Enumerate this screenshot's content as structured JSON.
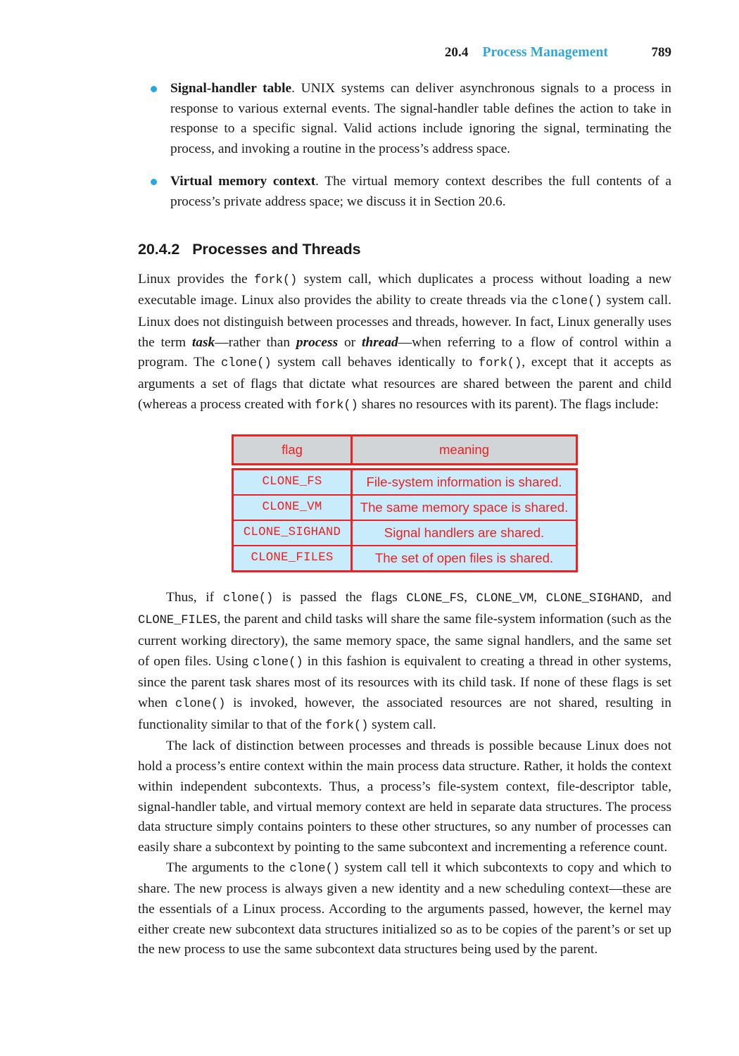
{
  "colors": {
    "accent_blue": "#2da5db",
    "bullet_blue": "#29a8de",
    "table_red": "#ee2020",
    "table_header_gray": "#d2d5d7",
    "table_row_blue": "#c8ecfb",
    "text_black": "#1a1a1a"
  },
  "header": {
    "section_number": "20.4",
    "section_title": "Process Management",
    "page_number": "789"
  },
  "bullets": [
    {
      "lead": "Signal-handler table",
      "text": ". UNIX systems can deliver asynchronous signals to a process in response to various external events. The signal-handler table defines the action to take in response to a specific signal. Valid actions include ignoring the signal, terminating the process, and invoking a routine in the process’s address space."
    },
    {
      "lead": "Virtual memory context",
      "text": ". The virtual memory context describes the full contents of a process’s private address space; we discuss it in Section 20.6."
    }
  ],
  "section": {
    "number": "20.4.2",
    "title": "Processes and Threads"
  },
  "paragraphs": {
    "p1": {
      "s1": "Linux provides the ",
      "c1": "fork()",
      "s2": " system call, which duplicates a process without loading a new executable image. Linux also provides the ability to create threads via the ",
      "c2": "clone()",
      "s3": " system call. Linux does not distinguish between processes and threads, however. In fact, Linux generally uses the term ",
      "i1": "task",
      "s4": "—rather than ",
      "i2": "process",
      "s5": " or ",
      "i3": "thread",
      "s6": "—when referring to a flow of control within a program. The ",
      "c3": "clone()",
      "s7": " system call behaves identically to ",
      "c4": "fork()",
      "s8": ", except that it accepts as arguments a set of flags that dictate what resources are shared between the parent and child (whereas a process created with ",
      "c5": "fork()",
      "s9": " shares no resources with its parent). The flags include:"
    },
    "p2": {
      "s1": "Thus, if ",
      "c1": "clone()",
      "s2": " is passed the flags ",
      "c2": "CLONE_FS",
      "s3": ", ",
      "c3": "CLONE_VM",
      "s4": ", ",
      "c4": "CLONE_SIGHAND",
      "s5": ", and ",
      "c5": "CLONE_FILES",
      "s6": ", the parent and child tasks will share the same file-system information (such as the current working directory), the same memory space, the same signal handlers, and the same set of open files. Using ",
      "c6": "clone()",
      "s7": " in this fashion is equivalent to creating a thread in other systems, since the parent task shares most of its resources with its child task. If none of these flags is set when ",
      "c7": "clone()",
      "s8": " is invoked, however, the associated resources are not shared, resulting in functionality similar to that of the ",
      "c8": "fork()",
      "s9": " system call."
    },
    "p3": {
      "s1": "The lack of distinction between processes and threads is possible because Linux does not hold a process’s entire context within the main process data structure. Rather, it holds the context within independent subcontexts. Thus, a process’s file-system context, file-descriptor table, signal-handler table, and virtual memory context are held in separate data structures. The process data structure simply contains pointers to these other structures, so any number of processes can easily share a subcontext by pointing to the same subcontext and incrementing a reference count."
    },
    "p4": {
      "s1": "The arguments to the ",
      "c1": "clone()",
      "s2": " system call tell it which subcontexts to copy and which to share. The new process is always given a new identity and a new scheduling context—these are the essentials of a Linux process. According to the arguments passed, however, the kernel may either create new subcontext data structures initialized so as to be copies of the parent’s or set up the new process to use the same subcontext data structures being used by the parent."
    }
  },
  "table": {
    "columns": [
      "flag",
      "meaning"
    ],
    "rows": [
      {
        "flag": "CLONE_FS",
        "meaning": "File-system information is shared."
      },
      {
        "flag": "CLONE_VM",
        "meaning": "The same memory space is shared."
      },
      {
        "flag": "CLONE_SIGHAND",
        "meaning": "Signal handlers are shared."
      },
      {
        "flag": "CLONE_FILES",
        "meaning": "The set of open files is shared."
      }
    ]
  }
}
